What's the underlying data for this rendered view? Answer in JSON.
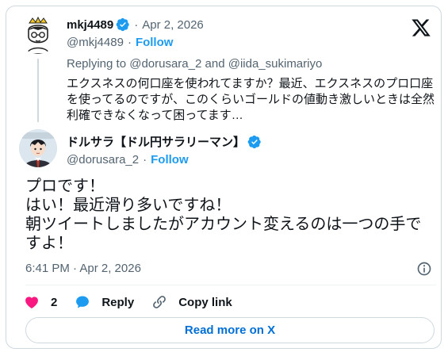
{
  "parent": {
    "name": "mkj4489",
    "dot": "·",
    "date": "Apr 2, 2026",
    "handle": "@mkj4489",
    "follow": "Follow",
    "replying_prefix": "Replying to ",
    "replying_to_1": "@dorusara_2",
    "replying_and": " and ",
    "replying_to_2": "@iida_sukimariyo",
    "text_lines": [
      "エクスネスの何口座を使われてますか？最近、エクスネスのプロ口座",
      "を使ってるのですが、このくらいゴールドの値動き激しいときは全然",
      "利確できなくなって困ってます…"
    ]
  },
  "main": {
    "name": "ドルサラ【ドル円サラリーマン】",
    "handle": "@dorusara_2",
    "dot": "·",
    "follow": "Follow",
    "text_lines": [
      "プロです！",
      "はい！最近滑り多いですね！",
      "朝ツイートしましたがアカウント変えるのは一つの手で",
      "すよ！"
    ],
    "timestamp": "6:41 PM · Apr 2, 2026"
  },
  "actions": {
    "like_count": "2",
    "reply_label": "Reply",
    "copy_label": "Copy link"
  },
  "read_more": "Read more on X",
  "icons": {
    "x_logo": "x-logo-icon",
    "verified": "verified-badge-icon",
    "info": "info-icon",
    "heart": "heart-icon",
    "reply": "speech-bubble-icon",
    "link": "link-icon"
  },
  "colors": {
    "accent_blue": "#1d9bf0",
    "like_pink": "#f91880",
    "text_secondary": "#536471",
    "read_more_blue": "#006fd6"
  }
}
